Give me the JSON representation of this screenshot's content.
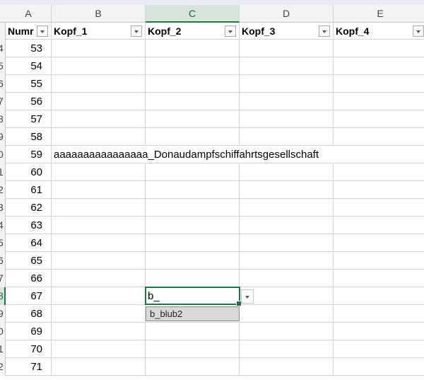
{
  "columns": [
    "A",
    "B",
    "C",
    "D",
    "E"
  ],
  "active_column": "C",
  "headers": {
    "A": "Numr",
    "B": "Kopf_1",
    "C": "Kopf_2",
    "D": "Kopf_3",
    "E": "Kopf_4"
  },
  "row_labels": [
    "4",
    "5",
    "6",
    "7",
    "8",
    "9",
    "0",
    "1",
    "2",
    "3",
    "4",
    "5",
    "6",
    "7",
    "8",
    "9",
    "0",
    "1",
    "2"
  ],
  "active_row_index": 14,
  "numbers": [
    "53",
    "54",
    "55",
    "56",
    "57",
    "58",
    "59",
    "60",
    "61",
    "62",
    "63",
    "64",
    "65",
    "66",
    "67",
    "68",
    "69",
    "70",
    "71"
  ],
  "long_text": {
    "row_index": 6,
    "value": "aaaaaaaaaaaaaaaa_Donaudampfschiffahrtsgesellschaft"
  },
  "editor": {
    "row_index": 14,
    "value": "b_"
  },
  "autocomplete": {
    "suggestion": "b_blub2"
  },
  "colors": {
    "accent": "#217346",
    "header_bg": "#f3f3f3",
    "gridline": "#d4d4d4"
  }
}
